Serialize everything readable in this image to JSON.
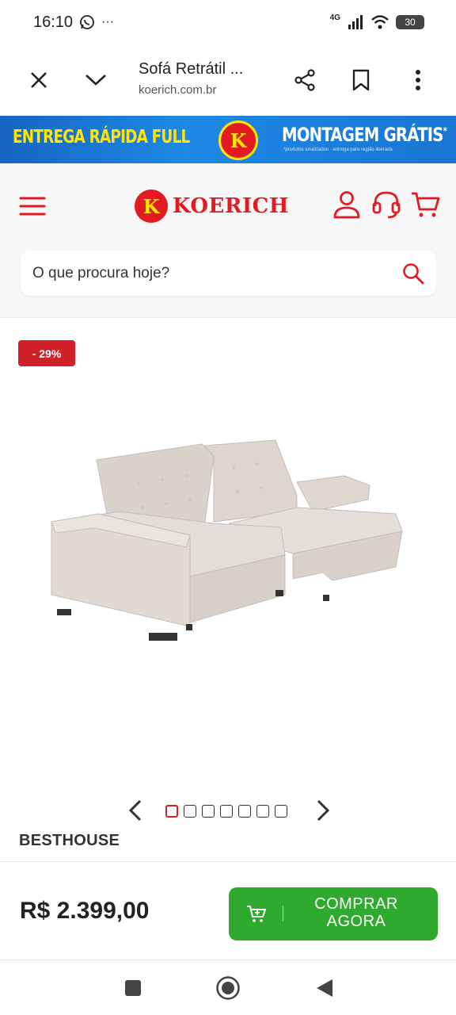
{
  "status_bar": {
    "time": "16:10",
    "more": "···",
    "network": "4G",
    "battery": "30"
  },
  "browser": {
    "title": "Sofá Retrátil ...",
    "url": "koerich.com.br",
    "icons": [
      "close-icon",
      "chevron-down-icon",
      "share-icon",
      "bookmark-icon",
      "more-vert-icon"
    ]
  },
  "promo": {
    "left_text": "ENTREGA RÁPIDA FULL",
    "logo_letter": "K",
    "right_text": "MONTAGEM GRÁTIS",
    "right_superscript": "*",
    "fine_print": "*produtos sinalizados · entrega para região liberada"
  },
  "header": {
    "logo_letter": "K",
    "logo_text": "KOERICH",
    "brand_color": "#e21b23",
    "search_placeholder": "O que procura hoje?"
  },
  "product": {
    "discount": "- 29%",
    "image_alt": "sofa-image",
    "brand": "BESTHOUSE",
    "carousel_total": 7,
    "carousel_active": 1,
    "price": "R$ 2.399,00",
    "buy_label_line1": "COMPRAR",
    "buy_label_line2": "AGORA",
    "buy_color": "#2eaa2e"
  },
  "nav": {
    "buttons": [
      "recents-icon",
      "home-icon",
      "back-icon"
    ]
  }
}
